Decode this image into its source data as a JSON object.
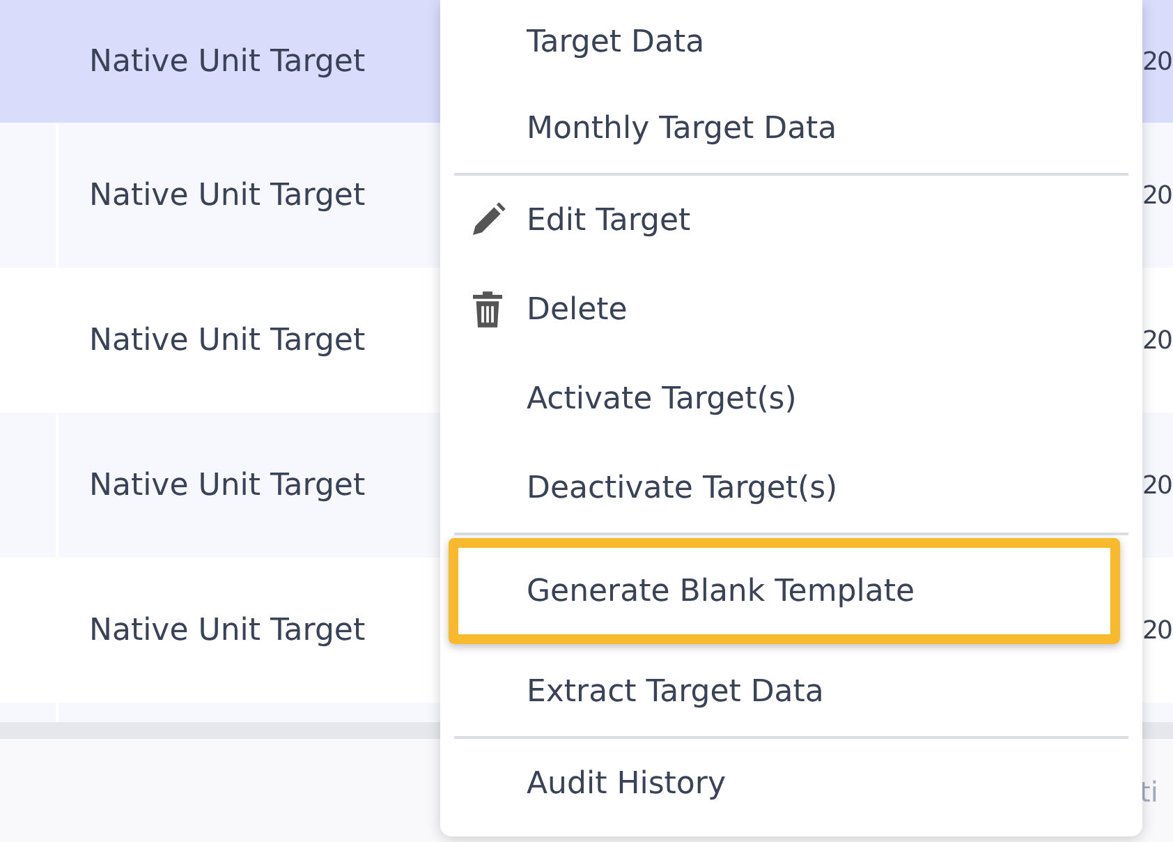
{
  "table": {
    "rows": [
      {
        "name": "Native Unit Target",
        "column_3": "20",
        "selected": true
      },
      {
        "name": "Native Unit Target",
        "column_3": "20",
        "selected": false
      },
      {
        "name": "Native Unit Target",
        "column_3": "20",
        "selected": false
      },
      {
        "name": "Native Unit Target",
        "column_3": "20",
        "selected": false
      },
      {
        "name": "Native Unit Target",
        "column_3": "20",
        "selected": false
      }
    ]
  },
  "footer": {
    "text": "ti"
  },
  "context_menu": {
    "items": [
      {
        "kind": "item",
        "label": "Target Data",
        "highlighted": false
      },
      {
        "kind": "item",
        "label": "Monthly Target Data",
        "highlighted": false
      },
      {
        "kind": "divider"
      },
      {
        "kind": "edit",
        "label": "Edit Target",
        "highlighted": false
      },
      {
        "kind": "delete",
        "label": "Delete",
        "highlighted": false
      },
      {
        "kind": "item",
        "label": "Activate Target(s)",
        "highlighted": false
      },
      {
        "kind": "item",
        "label": "Deactivate Target(s)",
        "highlighted": false
      },
      {
        "kind": "divider"
      },
      {
        "kind": "item",
        "label": "Generate Blank Template",
        "highlighted": true
      },
      {
        "kind": "item",
        "label": "Extract Target Data",
        "highlighted": false
      },
      {
        "kind": "divider"
      },
      {
        "kind": "item",
        "label": "Audit History",
        "highlighted": false
      }
    ]
  }
}
